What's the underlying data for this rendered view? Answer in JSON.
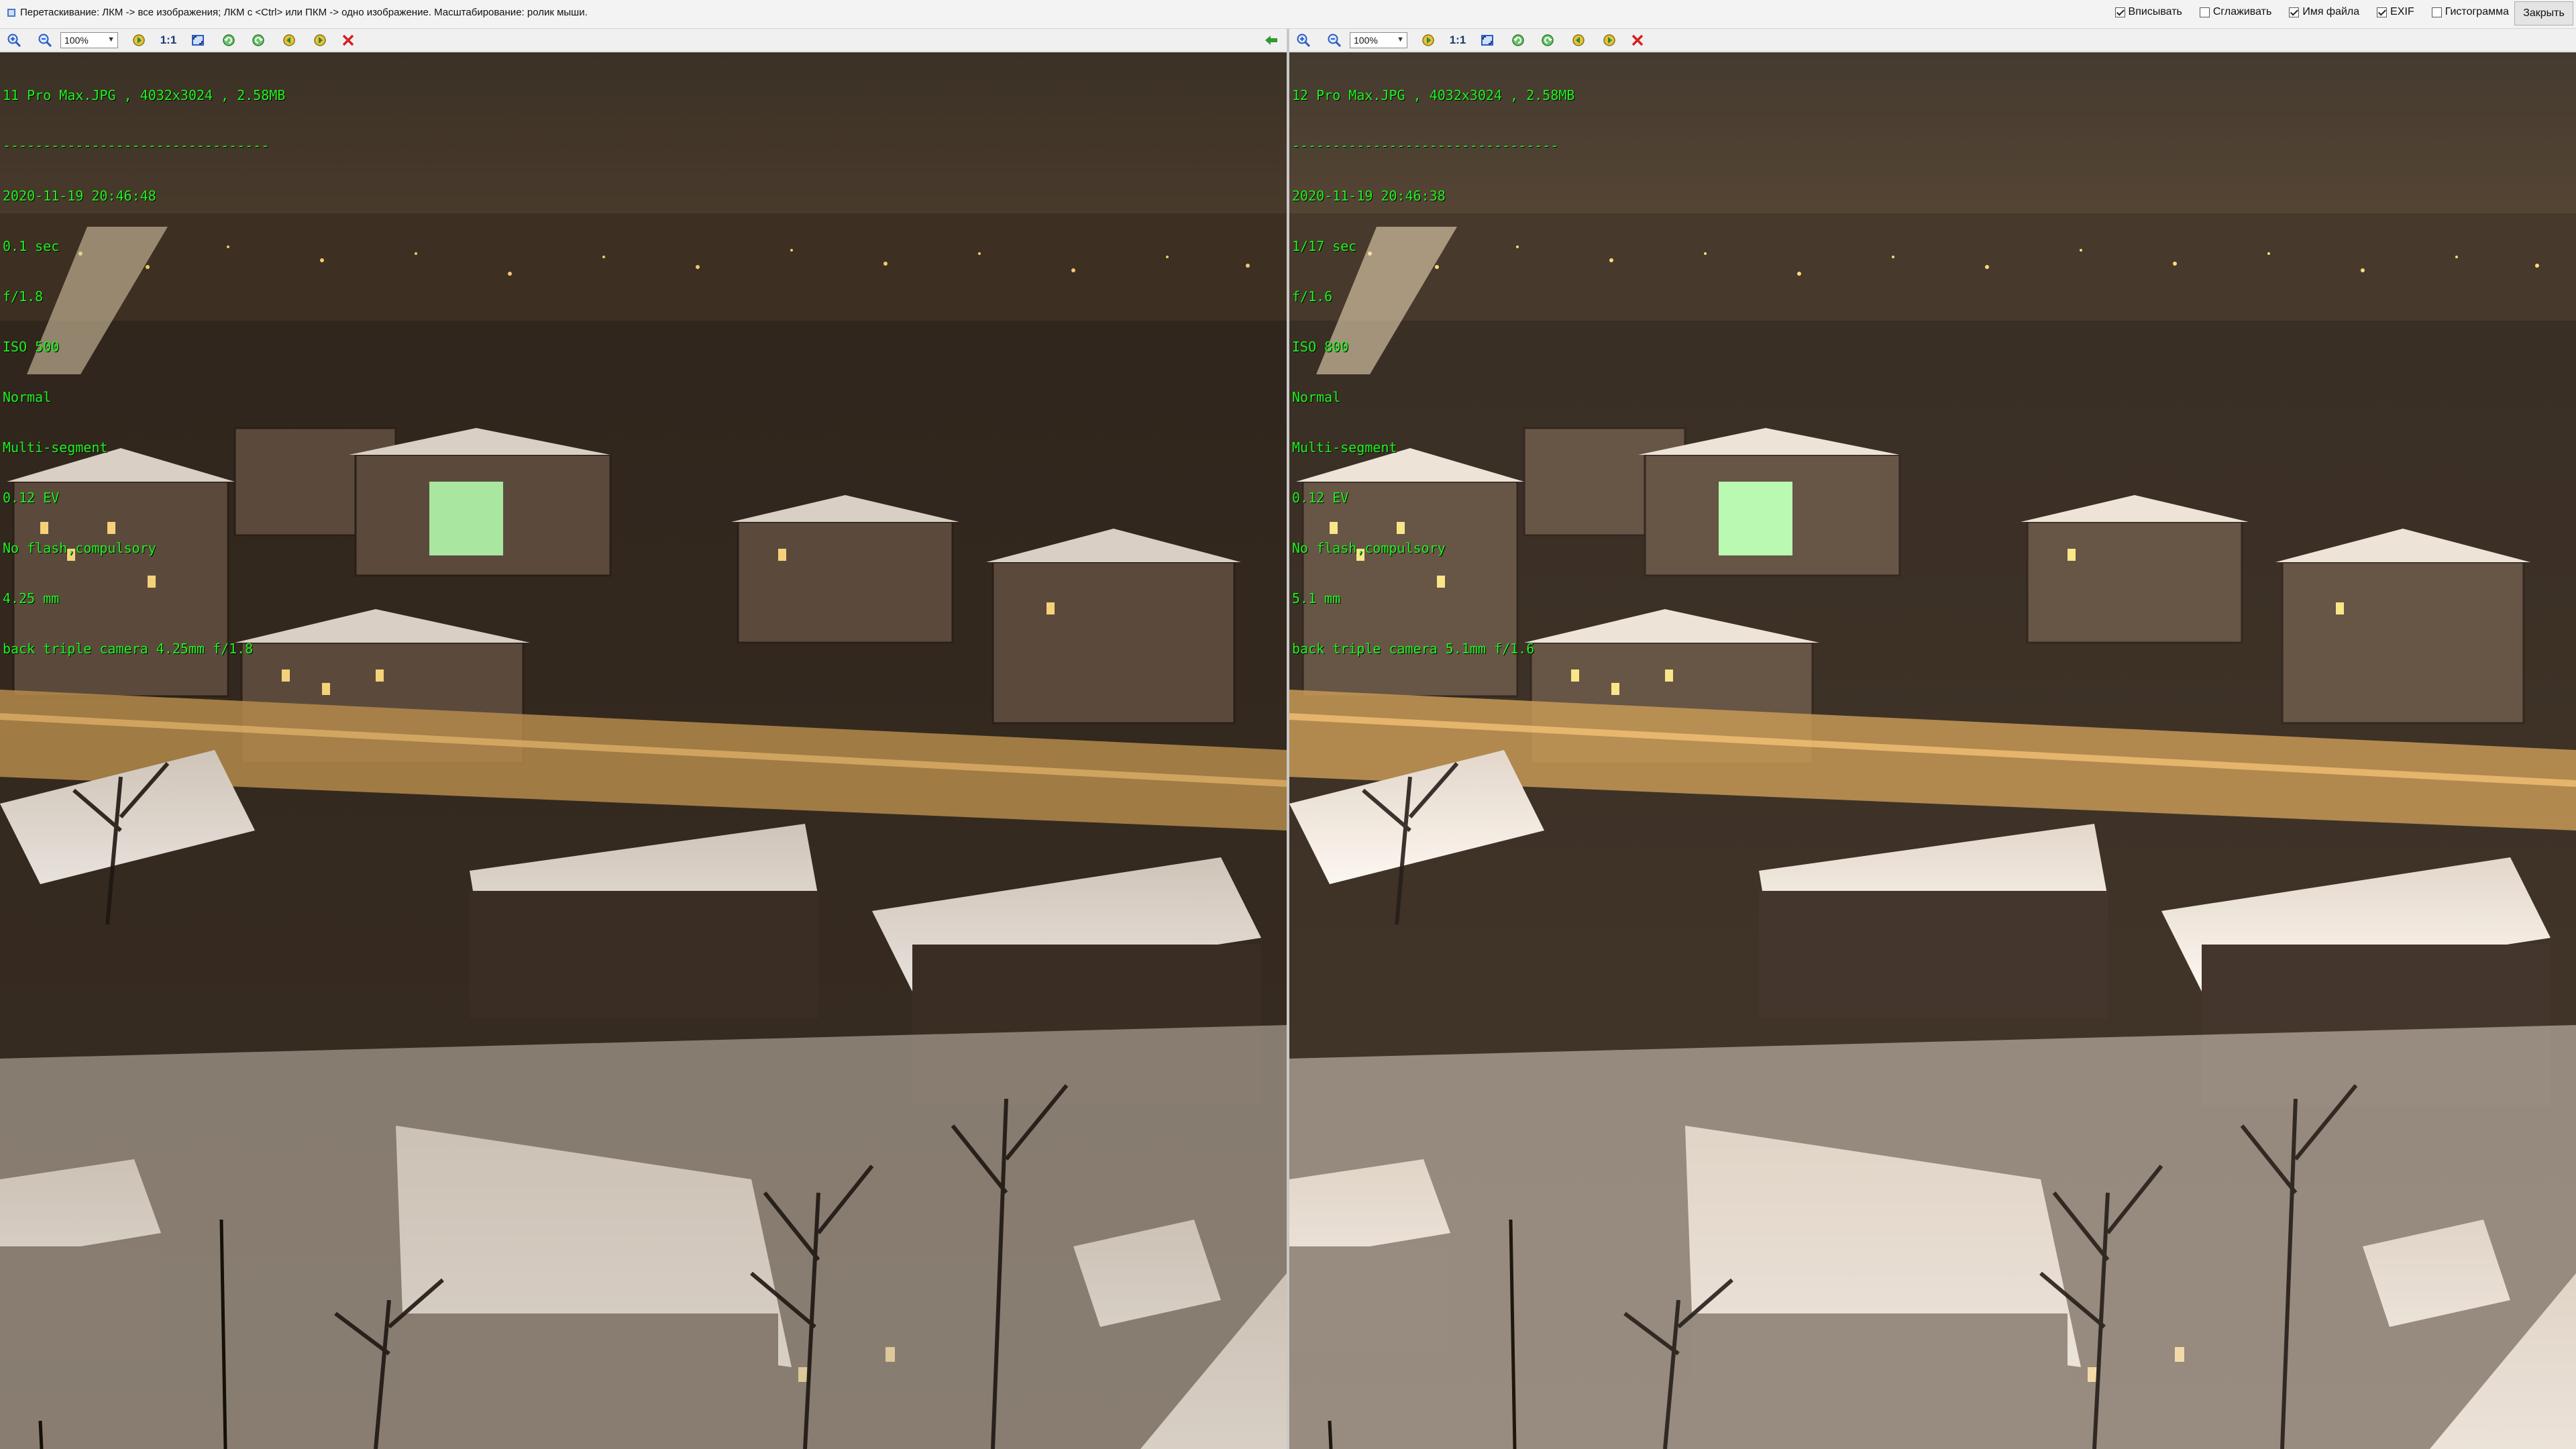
{
  "topbar": {
    "hint": "Перетаскивание: ЛКМ -> все изображения; ЛКМ с <Ctrl> или ПКМ -> одно изображение. Масштабирование: ролик мыши.",
    "options": [
      {
        "label": "Вписывать",
        "checked": true
      },
      {
        "label": "Сглаживать",
        "checked": false
      },
      {
        "label": "Имя файла",
        "checked": true
      },
      {
        "label": "EXIF",
        "checked": true
      },
      {
        "label": "Гистограмма",
        "checked": false
      }
    ],
    "close_label": "Закрыть"
  },
  "colors": {
    "overlay_text": "#1ff21f",
    "zoom_icon": "#2a5bbf",
    "nav_icon": "#2e8a2e",
    "delete_icon": "#d42020",
    "sync_arrow": "#2e9a2e"
  },
  "icons": [
    "zoom-in-icon",
    "zoom-out-icon",
    "fit-icon",
    "rotate-left-icon",
    "rotate-right-icon",
    "prev-icon",
    "next-icon",
    "delete-icon"
  ],
  "panes": [
    {
      "zoom": "100%",
      "one_to_one": "1:1",
      "exif": [
        "11 Pro Max.JPG , 4032x3024 , 2.58MB",
        "---------------------------------",
        "2020-11-19 20:46:48",
        "0.1 sec",
        "f/1.8",
        "ISO 500",
        "Normal",
        "Multi-segment",
        "0.12 EV",
        "No flash,compulsory",
        "4.25 mm",
        "back triple camera 4.25mm f/1.8"
      ]
    },
    {
      "zoom": "100%",
      "one_to_one": "1:1",
      "exif": [
        "12 Pro Max.JPG , 4032x3024 , 2.58MB",
        "---------------------------------",
        "2020-11-19 20:46:38",
        "1/17 sec",
        "f/1.6",
        "ISO 800",
        "Normal",
        "Multi-segment",
        "0.12 EV",
        "No flash,compulsory",
        "5.1 mm",
        "back triple camera 5.1mm f/1.6"
      ]
    }
  ]
}
